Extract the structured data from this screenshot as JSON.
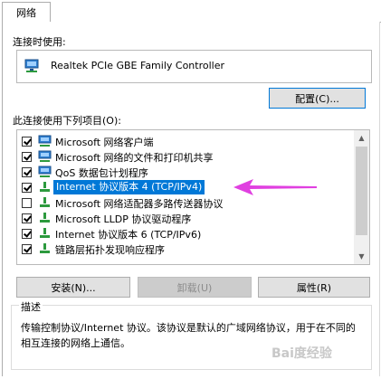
{
  "tab": {
    "label": "网络"
  },
  "connect_using": {
    "label": "连接时使用:",
    "adapter_name": "Realtek PCIe GBE Family Controller",
    "adapter_icon": "network-adapter-icon"
  },
  "buttons": {
    "configure": "配置(C)...",
    "install": "安装(N)...",
    "uninstall": "卸载(U)",
    "properties": "属性(R)"
  },
  "items_label": "此连接使用下列项目(O):",
  "items": [
    {
      "label": "Microsoft 网络客户端",
      "checked": true,
      "icon": "client-icon"
    },
    {
      "label": "Microsoft 网络的文件和打印机共享",
      "checked": true,
      "icon": "client-icon"
    },
    {
      "label": "QoS 数据包计划程序",
      "checked": true,
      "icon": "client-icon"
    },
    {
      "label": "Internet 协议版本 4 (TCP/IPv4)",
      "checked": true,
      "icon": "protocol-icon",
      "selected": true
    },
    {
      "label": "Microsoft 网络适配器多路传送器协议",
      "checked": false,
      "icon": "protocol-icon"
    },
    {
      "label": "Microsoft LLDP 协议驱动程序",
      "checked": true,
      "icon": "protocol-icon"
    },
    {
      "label": "Internet 协议版本 6 (TCP/IPv6)",
      "checked": true,
      "icon": "protocol-icon"
    },
    {
      "label": "链路层拓扑发现响应程序",
      "checked": true,
      "icon": "protocol-icon"
    }
  ],
  "description": {
    "title": "描述",
    "text": "传输控制协议/Internet 协议。该协议是默认的广域网络协议，用于在不同的相互连接的网络上通信。"
  },
  "annotation_color": "#e040e0",
  "watermark": "Bai度经验"
}
